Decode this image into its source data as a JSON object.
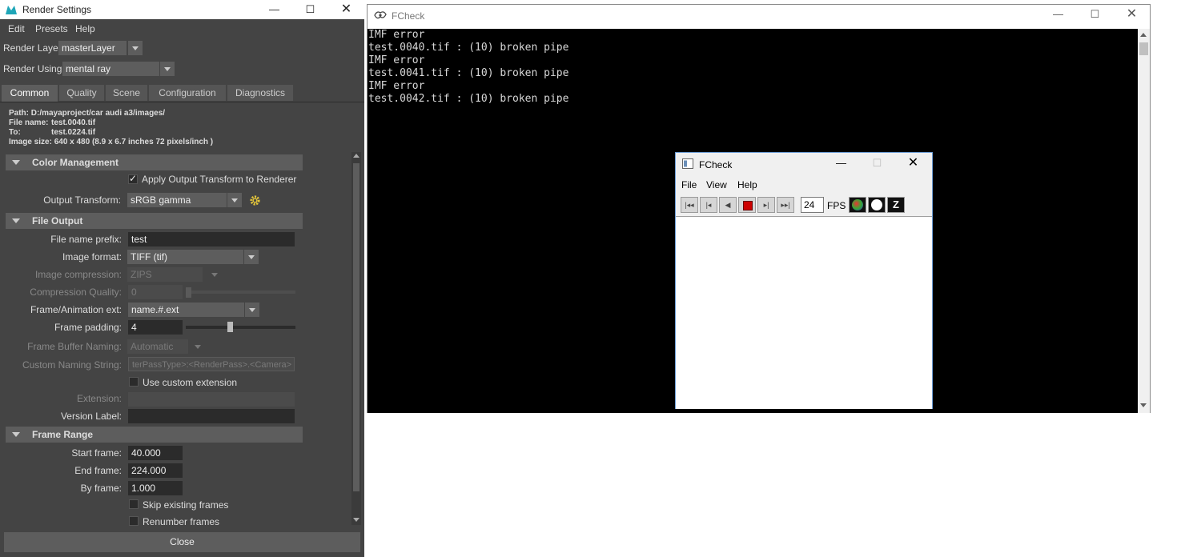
{
  "render_settings": {
    "title": "Render Settings",
    "menu": [
      "Edit",
      "Presets",
      "Help"
    ],
    "render_layer_label": "Render Layer",
    "render_layer_value": "masterLayer",
    "render_using_label": "Render Using",
    "render_using_value": "mental ray",
    "tabs": [
      "Common",
      "Quality",
      "Scene",
      "Configuration",
      "Diagnostics"
    ],
    "info": {
      "path": "Path: D:/mayaproject/car audi a3/images/",
      "file_name_label": "File name:",
      "file_name_value": "test.0040.tif",
      "to_label": "To:",
      "to_value": "test.0224.tif",
      "image_size": "Image size: 640 x 480 (8.9 x 6.7 inches 72 pixels/inch )"
    },
    "color_management": {
      "header": "Color Management",
      "apply_output_transform": "Apply Output Transform to Renderer",
      "output_transform_label": "Output Transform:",
      "output_transform_value": "sRGB gamma"
    },
    "file_output": {
      "header": "File Output",
      "file_name_prefix_label": "File name prefix:",
      "file_name_prefix_value": "test",
      "image_format_label": "Image format:",
      "image_format_value": "TIFF (tif)",
      "image_compression_label": "Image compression:",
      "image_compression_value": "ZIPS",
      "compression_quality_label": "Compression Quality:",
      "compression_quality_value": "0",
      "frame_ext_label": "Frame/Animation ext:",
      "frame_ext_value": "name.#.ext",
      "frame_padding_label": "Frame padding:",
      "frame_padding_value": "4",
      "frame_buffer_naming_label": "Frame Buffer Naming:",
      "frame_buffer_naming_value": "Automatic",
      "custom_naming_label": "Custom Naming String:",
      "custom_naming_value": "terPassType>:<RenderPass>.<Camera>",
      "use_custom_extension": "Use custom extension",
      "extension_label": "Extension:",
      "version_label_label": "Version Label:"
    },
    "frame_range": {
      "header": "Frame Range",
      "start_frame_label": "Start frame:",
      "start_frame_value": "40.000",
      "end_frame_label": "End frame:",
      "end_frame_value": "224.000",
      "by_frame_label": "By frame:",
      "by_frame_value": "1.000",
      "skip_existing": "Skip existing frames",
      "renumber": "Renumber frames"
    },
    "close_label": "Close"
  },
  "fcheck_console": {
    "title": "FCheck",
    "lines": [
      "IMF error",
      "test.0040.tif : (10) broken pipe",
      "IMF error",
      "test.0041.tif : (10) broken pipe",
      "IMF error",
      "test.0042.tif : (10) broken pipe"
    ]
  },
  "fcheck_viewer": {
    "title": "FCheck",
    "menu": [
      "File",
      "View",
      "Help"
    ],
    "fps_value": "24",
    "fps_label": "FPS"
  },
  "colors": {
    "panel_bg": "#444444",
    "section_header": "#5d5d5d",
    "field_bg": "#2b2b2b",
    "console_bg": "#000000",
    "stop_button": "#cc0000"
  }
}
